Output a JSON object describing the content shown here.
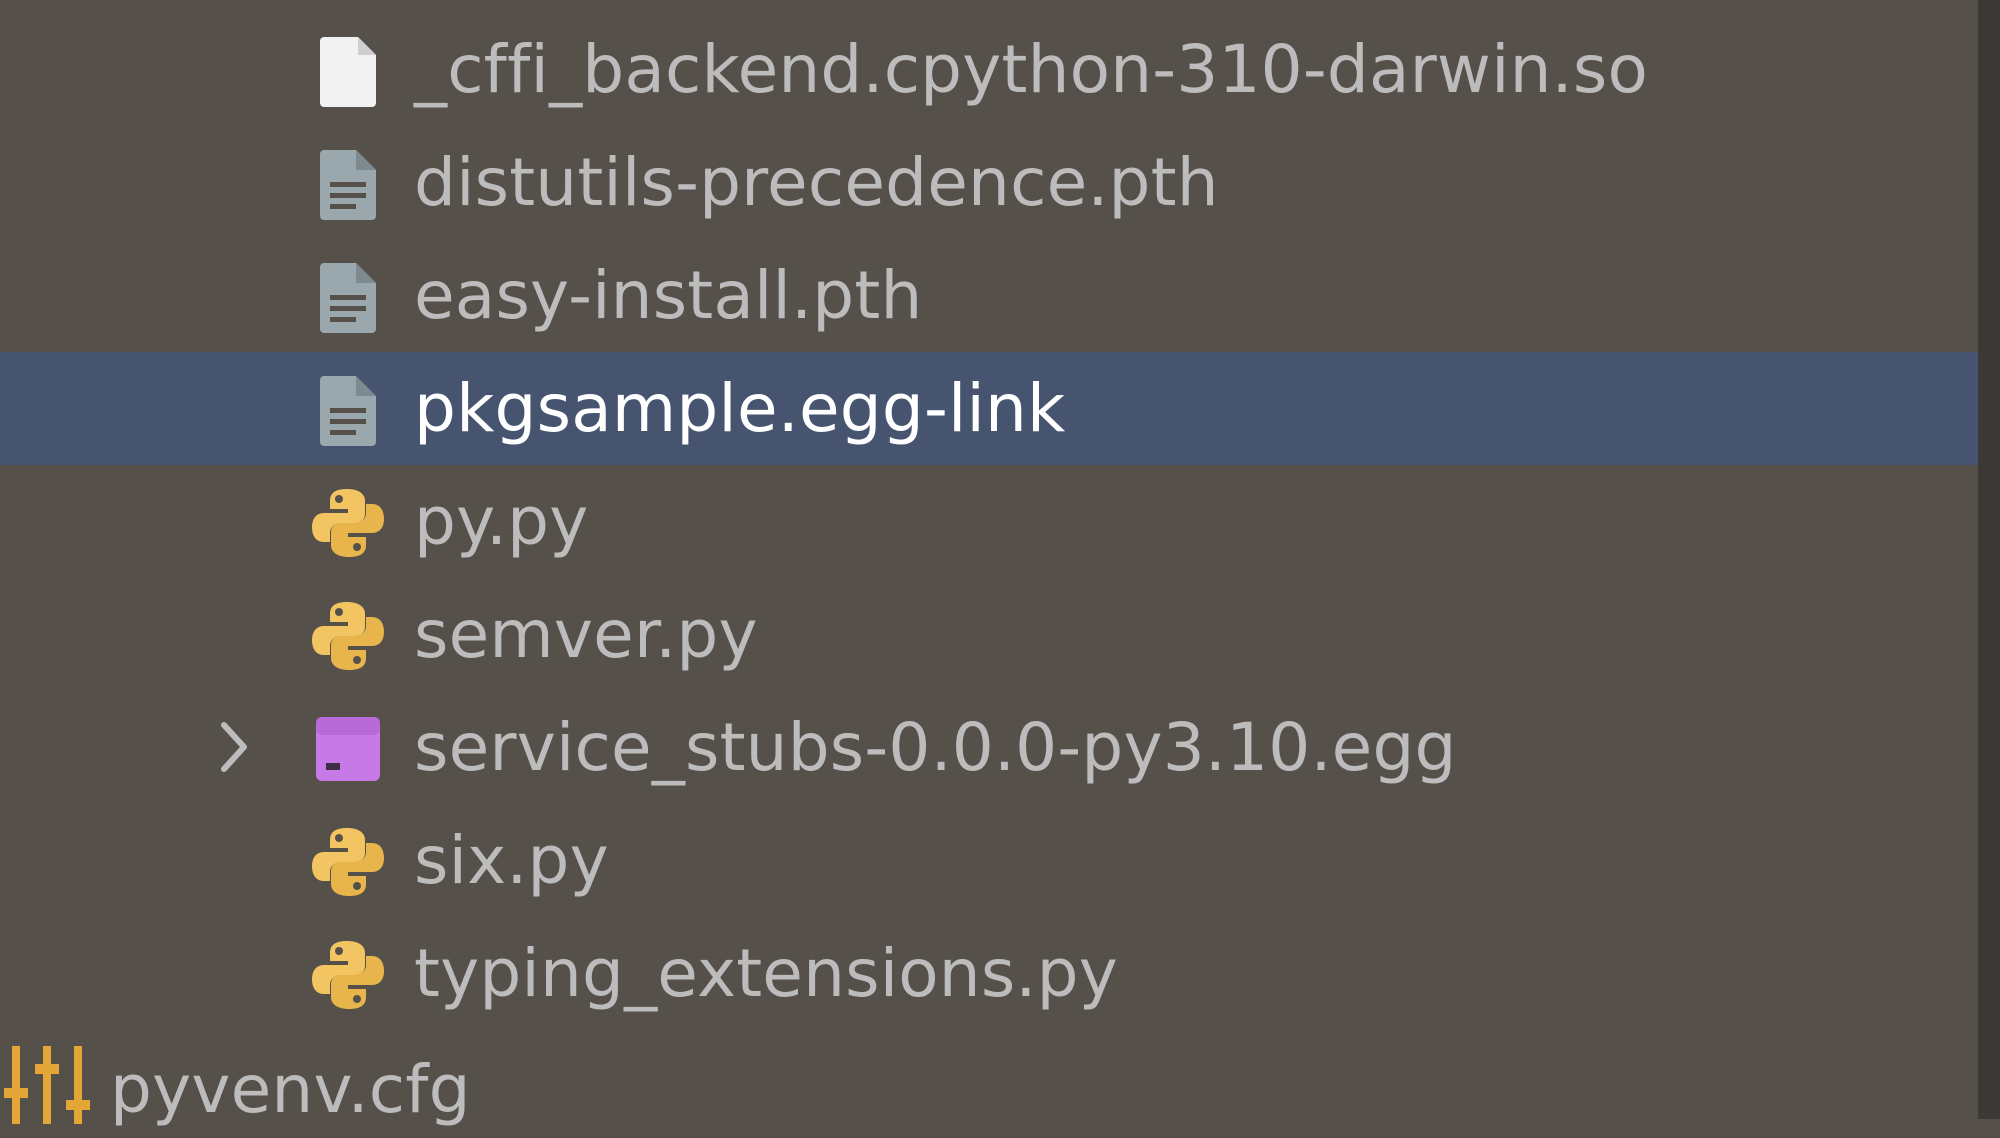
{
  "tree": {
    "items": [
      {
        "label": "_cffi_backend.cpython-310-darwin.so",
        "icon": "binary-file-icon",
        "expanded": false,
        "selected": false
      },
      {
        "label": "distutils-precedence.pth",
        "icon": "text-file-icon",
        "selected": false
      },
      {
        "label": "easy-install.pth",
        "icon": "text-file-icon",
        "selected": false
      },
      {
        "label": "pkgsample.egg-link",
        "icon": "text-file-icon",
        "selected": true
      },
      {
        "label": "py.py",
        "icon": "python-file-icon",
        "selected": false
      },
      {
        "label": "semver.py",
        "icon": "python-file-icon",
        "selected": false
      },
      {
        "label": "service_stubs-0.0.0-py3.10.egg",
        "icon": "archive-icon",
        "collapsed_chevron": true,
        "selected": false
      },
      {
        "label": "six.py",
        "icon": "python-file-icon",
        "selected": false
      },
      {
        "label": "typing_extensions.py",
        "icon": "python-file-icon",
        "selected": false
      }
    ],
    "root_item": {
      "label": "pyvenv.cfg",
      "icon": "config-file-icon"
    }
  },
  "colors": {
    "background": "#56504a",
    "selection": "#475470",
    "text": "#bdbcbc",
    "selected_text": "#ffffff",
    "python_yellow": "#f2c462",
    "archive_purple": "#c879e8",
    "text_file_gray": "#9aa7ad",
    "config_orange": "#e4a637"
  }
}
